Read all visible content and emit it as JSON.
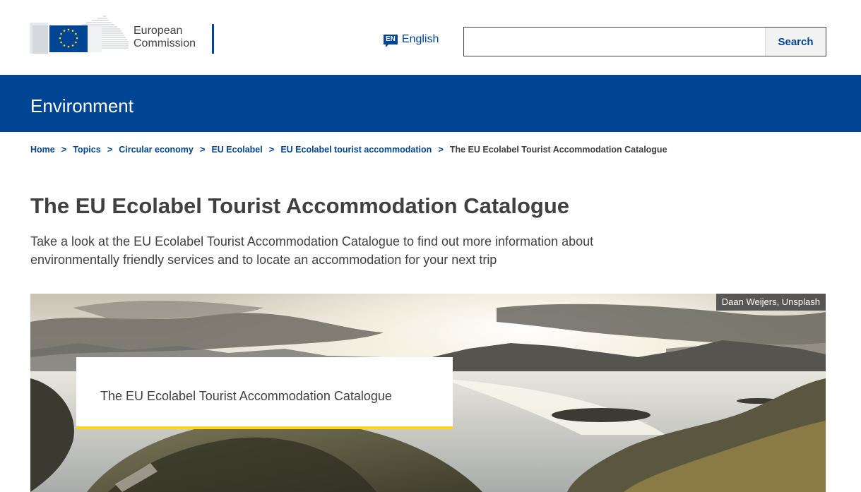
{
  "header": {
    "logo_line1": "European",
    "logo_line2": "Commission",
    "language": {
      "code": "EN",
      "label": "English"
    },
    "search": {
      "value": "",
      "placeholder": "",
      "button_label": "Search"
    }
  },
  "site": {
    "name": "Environment"
  },
  "breadcrumb": {
    "items": [
      "Home",
      "Topics",
      "Circular economy",
      "EU Ecolabel",
      "EU Ecolabel tourist accommodation"
    ],
    "current": "The EU Ecolabel Tourist Accommodation Catalogue",
    "separator": ">"
  },
  "page": {
    "title": "The EU Ecolabel Tourist Accommodation Catalogue",
    "intro": "Take a look at the EU Ecolabel Tourist Accommodation Catalogue to find out more information about environmentally friendly services and to locate an accommodation for your next trip"
  },
  "banner": {
    "credit": "Daan Weijers, Unsplash",
    "card_title": "The EU Ecolabel Tourist Accommodation Catalogue"
  },
  "colors": {
    "primary": "#004494",
    "accent": "#ffd617",
    "text": "#404040"
  }
}
